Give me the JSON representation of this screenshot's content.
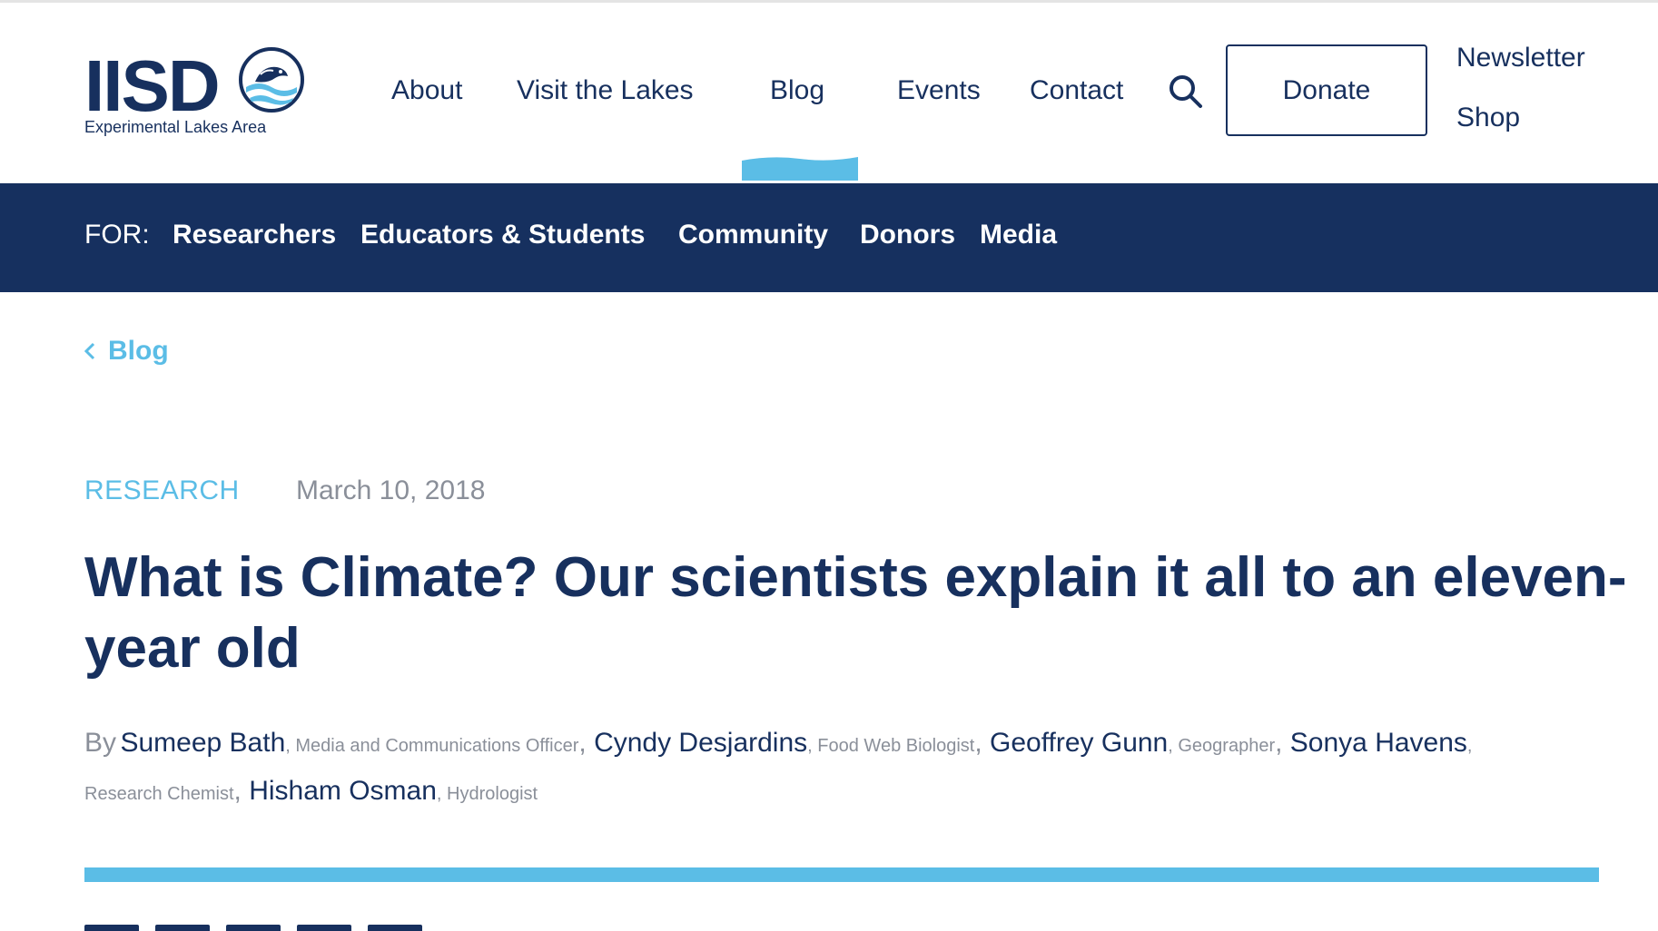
{
  "header": {
    "logo": {
      "name": "IISD",
      "subtitle": "Experimental Lakes Area"
    },
    "nav": [
      {
        "label": "About"
      },
      {
        "label": "Visit the Lakes"
      },
      {
        "label": "Blog",
        "active": true
      },
      {
        "label": "Events"
      },
      {
        "label": "Contact"
      }
    ],
    "search_icon": "search-icon",
    "donate_label": "Donate",
    "utility": [
      "Newsletter",
      "Shop"
    ]
  },
  "audience_bar": {
    "label": "FOR:",
    "links": [
      "Researchers",
      "Educators & Students",
      "Community",
      "Donors",
      "Media"
    ]
  },
  "breadcrumb": {
    "icon": "chevron-left-icon",
    "label": "Blog"
  },
  "article": {
    "category": "RESEARCH",
    "date": "March 10, 2018",
    "title": "What is Climate? Our scientists explain it all to an eleven-year old",
    "by_label": "By",
    "authors": [
      {
        "name": "Sumeep Bath",
        "role": "Media and Communications Officer"
      },
      {
        "name": "Cyndy Desjardins",
        "role": "Food Web Biologist"
      },
      {
        "name": "Geoffrey Gunn",
        "role": "Geographer"
      },
      {
        "name": "Sonya Havens",
        "role": "Research Chemist"
      },
      {
        "name": "Hisham Osman",
        "role": "Hydrologist"
      }
    ]
  },
  "colors": {
    "navy": "#17305e",
    "audience_bar": "#16305f",
    "accent": "#5bbde6",
    "muted": "#8a8f99"
  }
}
